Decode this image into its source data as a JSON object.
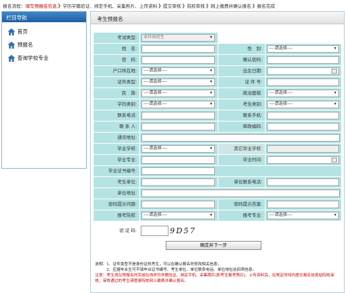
{
  "topbar": {
    "prefix": "报名流程：",
    "steps": [
      "填写预报名信息",
      "学历学籍验证、绑定手机、采集照片、上传资料",
      "提交审核",
      "院校审核",
      "网上缴费并确认报名",
      "报名完成"
    ]
  },
  "sidebar": {
    "title": "栏目导航",
    "items": [
      {
        "label": "首页",
        "icon": "home-icon"
      },
      {
        "label": "预报名",
        "icon": "home-icon"
      },
      {
        "label": "查询学校专业",
        "icon": "home-icon"
      }
    ]
  },
  "panel": {
    "title": "考生预报名"
  },
  "form": {
    "exam_type": {
      "label": "考试类型:",
      "value": "本科插班生"
    },
    "name": {
      "label": "姓　名:"
    },
    "gender": {
      "label": "性　别:",
      "value": "----请选择----"
    },
    "password": {
      "label": "密　码:"
    },
    "confirm_password": {
      "label": "确认密码:"
    },
    "hukou": {
      "label": "户口所在地:",
      "value": "----请选择----"
    },
    "birth_date": {
      "label": "出生日期:"
    },
    "id_type": {
      "label": "证件类型:",
      "value": "----请选择----"
    },
    "id_number": {
      "label": "证 件 号:"
    },
    "ethnicity": {
      "label": "民　族:",
      "value": "----请选择----"
    },
    "political": {
      "label": "政治面貌:",
      "value": "----请选择----"
    },
    "edu_category": {
      "label": "学历类别:",
      "value": "----请选择----"
    },
    "candidate_category": {
      "label": "考生类别:",
      "value": "----请选择----"
    },
    "phone": {
      "label": "联系电话:"
    },
    "mobile": {
      "label": "联系手机:"
    },
    "contact": {
      "label": "联 系 人:"
    },
    "postcode": {
      "label": "邮政编码:"
    },
    "address": {
      "label": "通讯地址:"
    },
    "grad_school": {
      "label": "毕业学校:",
      "value": "----请选择----"
    },
    "other_school": {
      "label": "其它毕业学校:"
    },
    "grad_major": {
      "label": "毕业专业:"
    },
    "grad_time": {
      "label": "毕业时间:"
    },
    "cert_number": {
      "label": "毕业证书编号:"
    },
    "work_unit": {
      "label": "考生单位:"
    },
    "unit_phone": {
      "label": "单位联系电话:"
    },
    "unit_address": {
      "label": "单位地址:"
    },
    "pwd_question": {
      "label": "密码提示问题:"
    },
    "pwd_answer": {
      "label": "密码提示答案:"
    },
    "apply_school": {
      "label": "报考院校:",
      "value": "----请选择----"
    },
    "apply_major": {
      "label": "报考专业:",
      "value": "----请选择----"
    },
    "captcha": {
      "label": "验 证 码:",
      "code": "9D57"
    },
    "submit_label": "确定并下一步"
  },
  "notes": {
    "line1": "说明：1、证件类型不是身份证的考生，可以在确认报名时修改相关信息；",
    "line2": "　　　2、应届毕业生可不填毕业证书编号、考生单位、单位联系电话、单位地址这四项信息。",
    "line3": "注意：考生须在预报名时完成在线学历学籍验证、绑定手机、采集照片(即考生报考照片)，上传资料后，在规定时间内提交报名信息给院校审核，审核通过的考生请登录院校网上缴费并确认报名。"
  }
}
